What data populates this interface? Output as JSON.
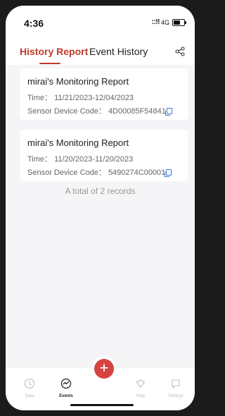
{
  "status_bar": {
    "time": "4:36",
    "signal": "::!!",
    "network": "4G"
  },
  "tabs": {
    "history_label": "History Report",
    "event_label": "Event History"
  },
  "reports": [
    {
      "title": "mirai's Monitoring Report",
      "time": "Time： 11/21/2023-12/04/2023",
      "code": "Sensor Device Code： 4D00085F54841"
    },
    {
      "title": "mirai's Monitoring Report",
      "time": "Time： 11/20/2023-11/20/2023",
      "code": "Sensor Device Code： 5490274C00001"
    }
  ],
  "total_text": "A total of 2 records",
  "nav": {
    "data": "Data",
    "events": "Events",
    "add": "+",
    "help": "Help",
    "settings": "Settings"
  },
  "colors": {
    "accent": "#c0392b",
    "fab": "#d64340",
    "link": "#3d7be0"
  }
}
